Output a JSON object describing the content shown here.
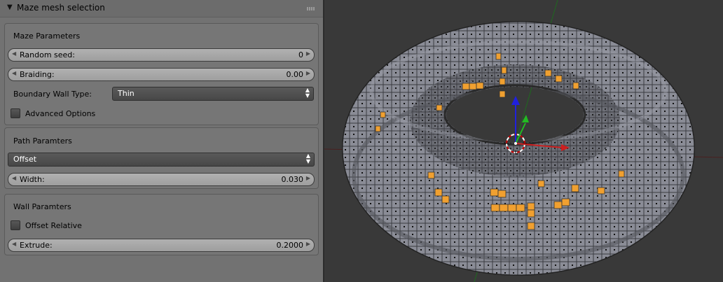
{
  "panel": {
    "title": "Maze mesh selection",
    "maze_parameters": {
      "heading": "Maze Parameters",
      "random_seed": {
        "label": "Random seed:",
        "value": "0"
      },
      "braiding": {
        "label": "Braiding:",
        "value": "0.00"
      },
      "boundary_wall_type": {
        "label": "Boundary Wall Type:",
        "value": "Thin"
      },
      "advanced_options": {
        "label": "Advanced Options",
        "checked": false
      }
    },
    "path_parameters": {
      "heading": "Path Paramters",
      "mode": "Offset",
      "width": {
        "label": "Width:",
        "value": "0.030"
      }
    },
    "wall_parameters": {
      "heading": "Wall Paramters",
      "offset_relative": {
        "label": "Offset Relative",
        "checked": false
      },
      "extrude": {
        "label": "Extrude:",
        "value": "0.2000"
      }
    }
  },
  "viewport": {
    "object": "torus maze mesh",
    "colors": {
      "background": "#393939",
      "mesh_face": "#8a8c96",
      "mesh_dark": "#5d5f66",
      "selected": "#f0a030",
      "axis_x": "#cc2020",
      "axis_y": "#22bb22",
      "axis_z": "#2020dd"
    },
    "icons": [
      "3d-cursor-icon",
      "transform-manipulator-icon"
    ]
  }
}
